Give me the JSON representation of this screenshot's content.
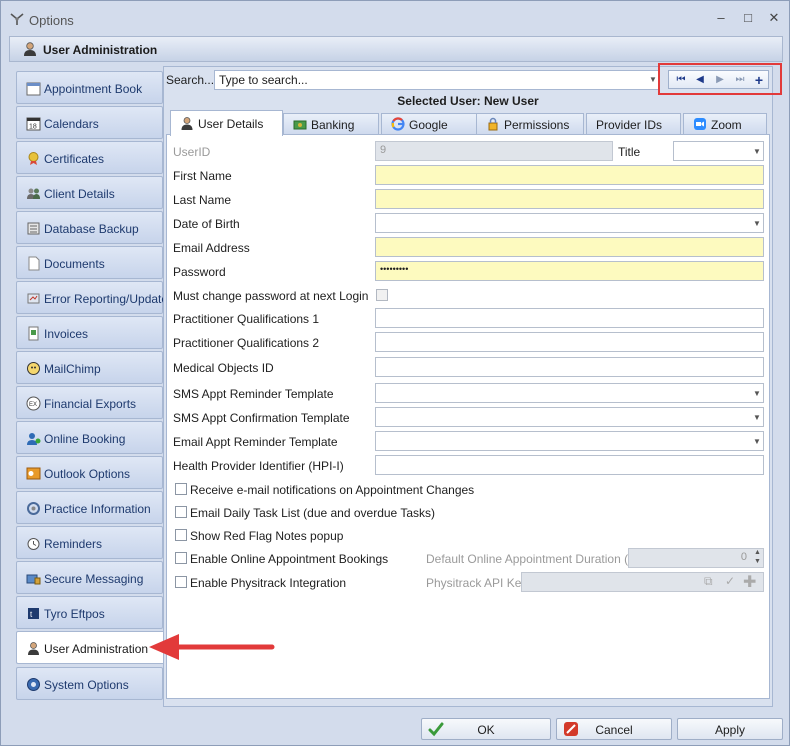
{
  "window": {
    "title": "Options",
    "controls": [
      "–",
      "□",
      "✕"
    ]
  },
  "header": {
    "title": "User Administration"
  },
  "sidebar": {
    "items": [
      {
        "label": "Appointment Book",
        "icon": "calendar-icon"
      },
      {
        "label": "Calendars",
        "icon": "calendar-18-icon"
      },
      {
        "label": "Certificates",
        "icon": "certificate-icon"
      },
      {
        "label": "Client Details",
        "icon": "people-icon"
      },
      {
        "label": "Database Backup",
        "icon": "database-icon"
      },
      {
        "label": "Documents",
        "icon": "document-icon"
      },
      {
        "label": "Error Reporting/Updates",
        "icon": "error-report-icon"
      },
      {
        "label": "Invoices",
        "icon": "invoice-icon"
      },
      {
        "label": "MailChimp",
        "icon": "mailchimp-icon"
      },
      {
        "label": "Financial Exports",
        "icon": "export-icon"
      },
      {
        "label": "Online Booking",
        "icon": "online-booking-icon"
      },
      {
        "label": "Outlook Options",
        "icon": "outlook-icon"
      },
      {
        "label": "Practice Information",
        "icon": "practice-icon"
      },
      {
        "label": "Reminders",
        "icon": "reminder-icon"
      },
      {
        "label": "Secure Messaging",
        "icon": "secure-message-icon"
      },
      {
        "label": "Tyro Eftpos",
        "icon": "tyro-icon"
      },
      {
        "label": "User Administration",
        "icon": "user-icon"
      },
      {
        "label": "System Options",
        "icon": "system-icon"
      }
    ],
    "active_index": 16
  },
  "search": {
    "label": "Search...",
    "value": "Type to search..."
  },
  "selected_user": "Selected User: New User",
  "tabs": [
    {
      "label": "User Details",
      "icon": "user-icon"
    },
    {
      "label": "Banking",
      "icon": "banking-icon"
    },
    {
      "label": "Google",
      "icon": "google-icon"
    },
    {
      "label": "Permissions",
      "icon": "lock-icon"
    },
    {
      "label": "Provider IDs",
      "icon": ""
    },
    {
      "label": "Zoom",
      "icon": "zoom-icon"
    }
  ],
  "form": {
    "userid_label": "UserID",
    "userid_value": "9",
    "title_label": "Title",
    "first_name_label": "First Name",
    "last_name_label": "Last Name",
    "dob_label": "Date of Birth",
    "email_label": "Email Address",
    "password_label": "Password",
    "password_value": "•••••••••",
    "must_change_label": "Must change password at next Login",
    "qual1_label": "Practitioner Qualifications 1",
    "qual2_label": "Practitioner Qualifications 2",
    "medical_objects_label": "Medical Objects ID",
    "sms_reminder_label": "SMS Appt Reminder Template",
    "sms_confirm_label": "SMS Appt Confirmation Template",
    "email_reminder_label": "Email Appt Reminder Template",
    "hpi_label": "Health Provider Identifier (HPI-I)",
    "chk_notifications": "Receive e-mail notifications on Appointment Changes",
    "chk_task_list": "Email Daily Task List (due and overdue Tasks)",
    "chk_red_flag": "Show Red Flag Notes popup",
    "chk_online_bookings": "Enable Online Appointment Bookings",
    "duration_label": "Default Online Appointment Duration (min)",
    "duration_value": "0",
    "chk_physitrack": "Enable Physitrack Integration",
    "physitrack_label": "Physitrack API Key"
  },
  "buttons": {
    "ok": "OK",
    "cancel": "Cancel",
    "apply": "Apply"
  },
  "colors": {
    "highlight": "#e23a3a",
    "required_field": "#fdfabf",
    "accent": "#1e3a8a"
  }
}
